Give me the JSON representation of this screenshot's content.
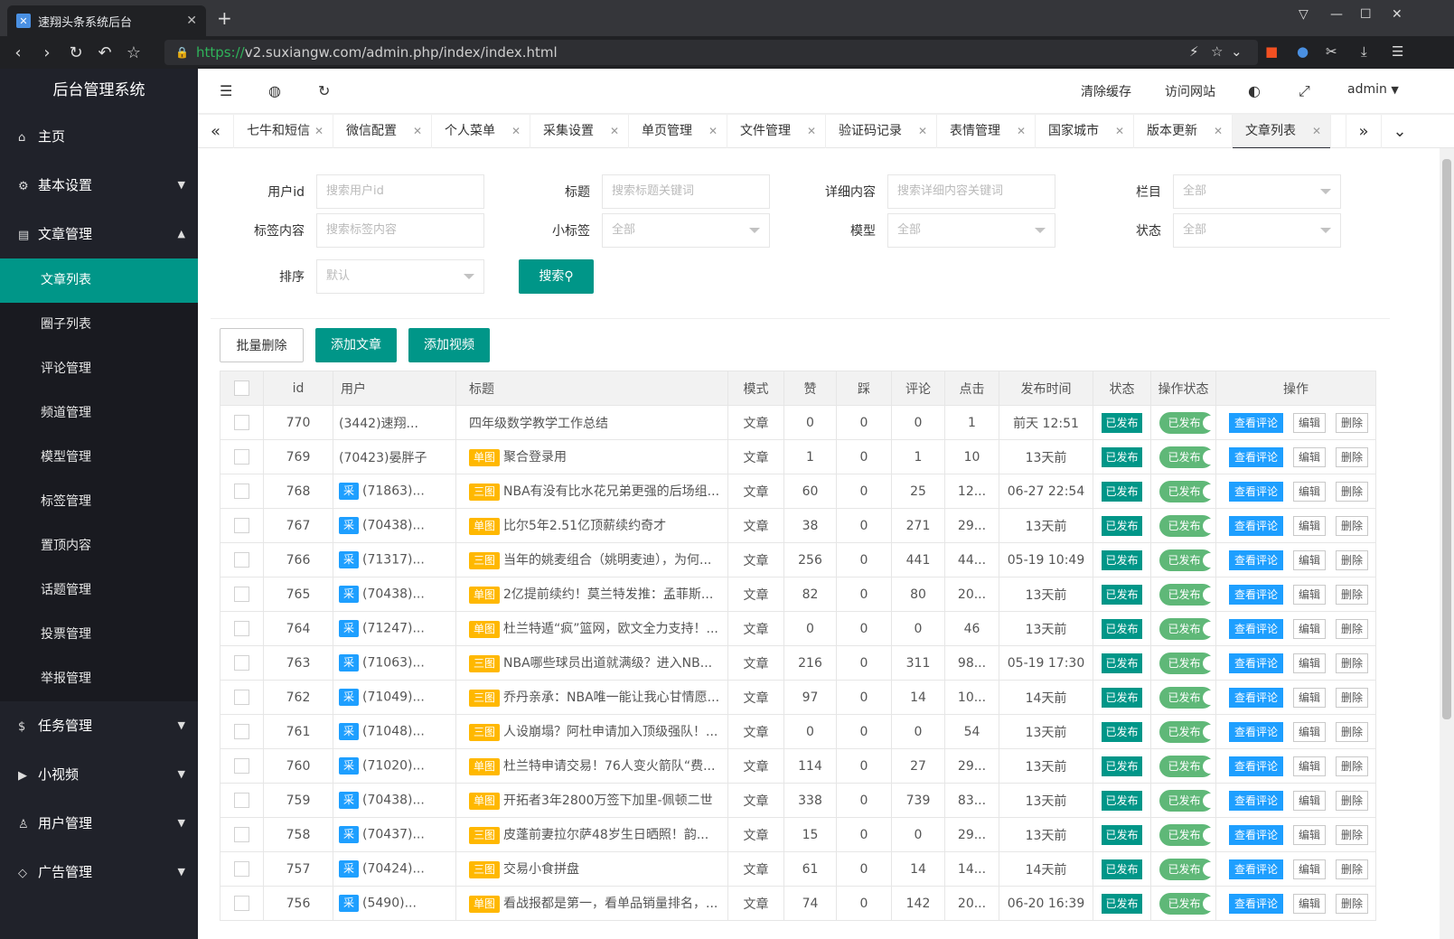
{
  "browser": {
    "tab_title": "速翔头条系统后台",
    "url_https": "https://",
    "url_rest": "v2.suxiangw.com/admin.php/index/index.html"
  },
  "sidebar": {
    "title": "后台管理系统",
    "items": [
      {
        "label": "主页",
        "icon": "home-icon"
      },
      {
        "label": "基本设置",
        "icon": "gear-icon"
      },
      {
        "label": "文章管理",
        "icon": "document-icon"
      }
    ],
    "sub_items": [
      "文章列表",
      "圈子列表",
      "评论管理",
      "频道管理",
      "模型管理",
      "标签管理",
      "置顶内容",
      "话题管理",
      "投票管理",
      "举报管理"
    ],
    "items_after": [
      {
        "label": "任务管理",
        "icon": "dollar-icon"
      },
      {
        "label": "小视频",
        "icon": "play-icon"
      },
      {
        "label": "用户管理",
        "icon": "user-icon"
      },
      {
        "label": "广告管理",
        "icon": "tag-icon"
      }
    ]
  },
  "header": {
    "clear_cache": "清除缓存",
    "visit_site": "访问网站",
    "user": "admin"
  },
  "tabs": [
    "七牛和短信",
    "微信配置",
    "个人菜单",
    "采集设置",
    "单页管理",
    "文件管理",
    "验证码记录",
    "表情管理",
    "国家城市",
    "版本更新",
    "文章列表"
  ],
  "filters": {
    "user_id_label": "用户id",
    "user_id_ph": "搜索用户id",
    "title_label": "标题",
    "title_ph": "搜索标题关键词",
    "detail_label": "详细内容",
    "detail_ph": "搜索详细内容关键词",
    "column_label": "栏目",
    "column_val": "全部",
    "tag_label": "标签内容",
    "tag_ph": "搜索标签内容",
    "small_tag_label": "小标签",
    "small_tag_val": "全部",
    "model_label": "模型",
    "model_val": "全部",
    "status_label": "状态",
    "status_val": "全部",
    "sort_label": "排序",
    "sort_val": "默认",
    "search_btn": "搜索"
  },
  "actions": {
    "batch_delete": "批量删除",
    "add_article": "添加文章",
    "add_video": "添加视频"
  },
  "table": {
    "headers": [
      "id",
      "用户",
      "标题",
      "模式",
      "赞",
      "踩",
      "评论",
      "点击",
      "发布时间",
      "状态",
      "操作状态",
      "操作"
    ],
    "status_label": "已发布",
    "op_state_label": "已发布",
    "view_btn": "查看评论",
    "edit_btn": "编辑",
    "delete_btn": "删除",
    "rows": [
      {
        "id": "770",
        "badge": "",
        "user": "(3442)速翔...",
        "tbadge": "",
        "title": "四年级数学教学工作总结",
        "mode": "文章",
        "like": "0",
        "dislike": "0",
        "comments": "0",
        "clicks": "1",
        "time": "前天 12:51"
      },
      {
        "id": "769",
        "badge": "",
        "user": "(70423)晏胖子",
        "tbadge": "单图",
        "title": "聚合登录用",
        "mode": "文章",
        "like": "1",
        "dislike": "0",
        "comments": "1",
        "clicks": "10",
        "time": "13天前"
      },
      {
        "id": "768",
        "badge": "采",
        "user": "(71863)...",
        "tbadge": "三图",
        "title": "NBA有没有比水花兄弟更强的后场组...",
        "mode": "文章",
        "like": "60",
        "dislike": "0",
        "comments": "25",
        "clicks": "12...",
        "time": "06-27 22:54"
      },
      {
        "id": "767",
        "badge": "采",
        "user": "(70438)...",
        "tbadge": "单图",
        "title": "比尔5年2.51亿顶薪续约奇才",
        "mode": "文章",
        "like": "38",
        "dislike": "0",
        "comments": "271",
        "clicks": "29...",
        "time": "13天前"
      },
      {
        "id": "766",
        "badge": "采",
        "user": "(71317)...",
        "tbadge": "三图",
        "title": "当年的姚麦组合（姚明麦迪），为何...",
        "mode": "文章",
        "like": "256",
        "dislike": "0",
        "comments": "441",
        "clicks": "44...",
        "time": "05-19 10:49"
      },
      {
        "id": "765",
        "badge": "采",
        "user": "(70438)...",
        "tbadge": "单图",
        "title": "2亿提前续约！莫兰特发推：孟菲斯...",
        "mode": "文章",
        "like": "82",
        "dislike": "0",
        "comments": "80",
        "clicks": "20...",
        "time": "13天前"
      },
      {
        "id": "764",
        "badge": "采",
        "user": "(71247)...",
        "tbadge": "单图",
        "title": "杜兰特遁“疯”篮网，欧文全力支持！...",
        "mode": "文章",
        "like": "0",
        "dislike": "0",
        "comments": "0",
        "clicks": "46",
        "time": "13天前"
      },
      {
        "id": "763",
        "badge": "采",
        "user": "(71063)...",
        "tbadge": "三图",
        "title": "NBA哪些球员出道就满级？进入NB...",
        "mode": "文章",
        "like": "216",
        "dislike": "0",
        "comments": "311",
        "clicks": "98...",
        "time": "05-19 17:30"
      },
      {
        "id": "762",
        "badge": "采",
        "user": "(71049)...",
        "tbadge": "三图",
        "title": "乔丹亲承：NBA唯一能让我心甘情愿...",
        "mode": "文章",
        "like": "97",
        "dislike": "0",
        "comments": "14",
        "clicks": "10...",
        "time": "14天前"
      },
      {
        "id": "761",
        "badge": "采",
        "user": "(71048)...",
        "tbadge": "三图",
        "title": "人设崩塌？阿杜申请加入顶级强队！...",
        "mode": "文章",
        "like": "0",
        "dislike": "0",
        "comments": "0",
        "clicks": "54",
        "time": "13天前"
      },
      {
        "id": "760",
        "badge": "采",
        "user": "(71020)...",
        "tbadge": "单图",
        "title": "杜兰特申请交易！76人变火箭队“费...",
        "mode": "文章",
        "like": "114",
        "dislike": "0",
        "comments": "27",
        "clicks": "29...",
        "time": "13天前"
      },
      {
        "id": "759",
        "badge": "采",
        "user": "(70438)...",
        "tbadge": "单图",
        "title": "开拓者3年2800万签下加里-佩顿二世",
        "mode": "文章",
        "like": "338",
        "dislike": "0",
        "comments": "739",
        "clicks": "83...",
        "time": "13天前"
      },
      {
        "id": "758",
        "badge": "采",
        "user": "(70437)...",
        "tbadge": "三图",
        "title": "皮蓬前妻拉尔萨48岁生日晒照！韵...",
        "mode": "文章",
        "like": "15",
        "dislike": "0",
        "comments": "0",
        "clicks": "29...",
        "time": "13天前"
      },
      {
        "id": "757",
        "badge": "采",
        "user": "(70424)...",
        "tbadge": "三图",
        "title": "交易小食拼盘",
        "mode": "文章",
        "like": "61",
        "dislike": "0",
        "comments": "14",
        "clicks": "14...",
        "time": "14天前"
      },
      {
        "id": "756",
        "badge": "采",
        "user": "(5490)...",
        "tbadge": "单图",
        "title": "看战报都是第一，看单品销量排名，...",
        "mode": "文章",
        "like": "74",
        "dislike": "0",
        "comments": "142",
        "clicks": "20...",
        "time": "06-20 16:39"
      }
    ]
  },
  "colors": {
    "accent": "#009688",
    "sidebar": "#20222a",
    "blue": "#1e9fff",
    "orange": "#ffb800",
    "switch": "#5fb878"
  }
}
